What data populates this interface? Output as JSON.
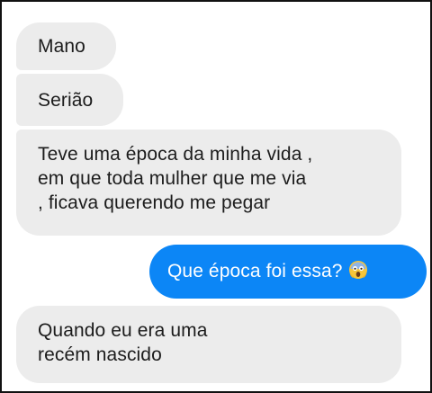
{
  "conversation": {
    "messages": [
      {
        "direction": "incoming",
        "lines": [
          "Mano"
        ]
      },
      {
        "direction": "incoming",
        "lines": [
          "Serião"
        ]
      },
      {
        "direction": "incoming",
        "lines": [
          "Teve uma época da minha vida ,",
          "em que toda mulher que me via",
          ", ficava querendo me pegar"
        ]
      },
      {
        "direction": "outgoing",
        "lines": [
          "Que época foi essa?"
        ],
        "emoji": "screaming-face-icon"
      },
      {
        "direction": "incoming",
        "lines": [
          "Quando eu era uma",
          "recém nascido"
        ]
      }
    ]
  },
  "colors": {
    "incoming_bubble": "#ececec",
    "outgoing_bubble": "#0c86f6",
    "incoming_text": "#1c1c1c",
    "outgoing_text": "#ffffff"
  }
}
